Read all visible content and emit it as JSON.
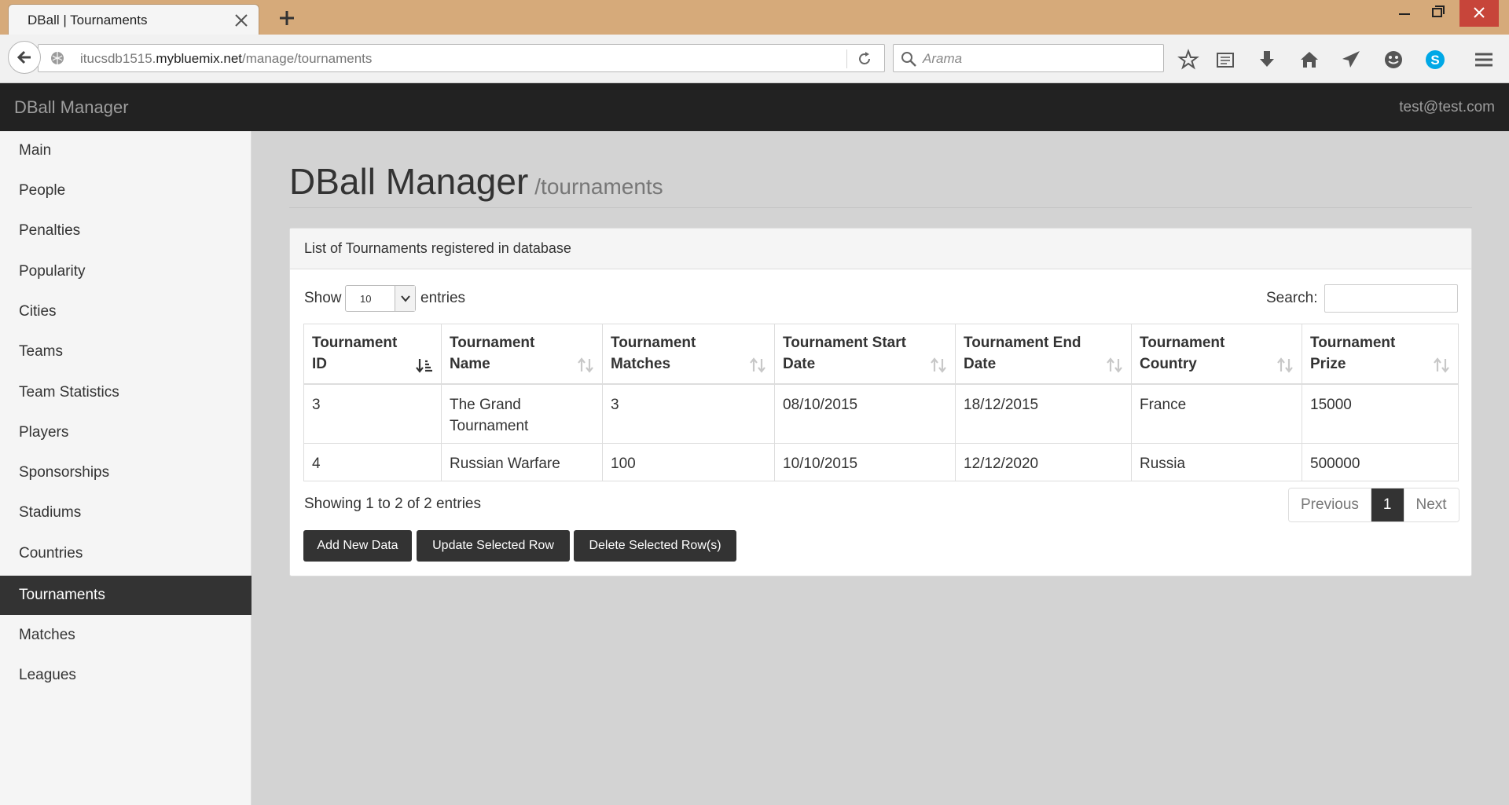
{
  "browser": {
    "tab_title": "DBall | Tournaments",
    "url_prefix": "itucsdb1515.",
    "url_host": "mybluemix.net",
    "url_path": "/manage/tournaments",
    "search_placeholder": "Arama"
  },
  "app": {
    "brand": "DBall Manager",
    "user": "test@test.com"
  },
  "sidebar": {
    "items": [
      {
        "label": "Main"
      },
      {
        "label": "People"
      },
      {
        "label": "Penalties"
      },
      {
        "label": "Popularity"
      },
      {
        "label": "Cities"
      },
      {
        "label": "Teams"
      },
      {
        "label": "Team Statistics"
      },
      {
        "label": "Players"
      },
      {
        "label": "Sponsorships"
      },
      {
        "label": "Stadiums"
      },
      {
        "label": "Countries"
      },
      {
        "label": "Tournaments",
        "active": true
      },
      {
        "label": "Matches"
      },
      {
        "label": "Leagues"
      }
    ]
  },
  "page": {
    "title": "DBall Manager",
    "subtitle": "/tournaments"
  },
  "panel": {
    "heading": "List of Tournaments registered in database",
    "show_label": "Show",
    "entries_label": "entries",
    "page_length": "10",
    "search_label": "Search:",
    "search_value": ""
  },
  "table": {
    "columns": [
      "Tournament ID",
      "Tournament Name",
      "Tournament Matches",
      "Tournament Start Date",
      "Tournament End Date",
      "Tournament Country",
      "Tournament Prize"
    ],
    "rows": [
      [
        "3",
        "The Grand Tournament",
        "3",
        "08/10/2015",
        "18/12/2015",
        "France",
        "15000"
      ],
      [
        "4",
        "Russian Warfare",
        "100",
        "10/10/2015",
        "12/12/2020",
        "Russia",
        "500000"
      ]
    ]
  },
  "footer": {
    "info": "Showing 1 to 2 of 2 entries",
    "prev": "Previous",
    "page": "1",
    "next": "Next"
  },
  "actions": {
    "add": "Add New Data",
    "update": "Update Selected Row",
    "delete": "Delete Selected Row(s)"
  },
  "colors": {
    "titlebar": "#d6aa7a",
    "appbar": "#222222",
    "active": "#333333",
    "skype": "#00a8e6"
  },
  "icons": [
    "close-icon",
    "plus-icon",
    "back-arrow-icon",
    "globe-icon",
    "reload-icon",
    "search-icon",
    "star-icon",
    "reading-list-icon",
    "download-icon",
    "home-icon",
    "send-icon",
    "smiley-icon",
    "skype-icon",
    "menu-icon",
    "sort-icon"
  ]
}
